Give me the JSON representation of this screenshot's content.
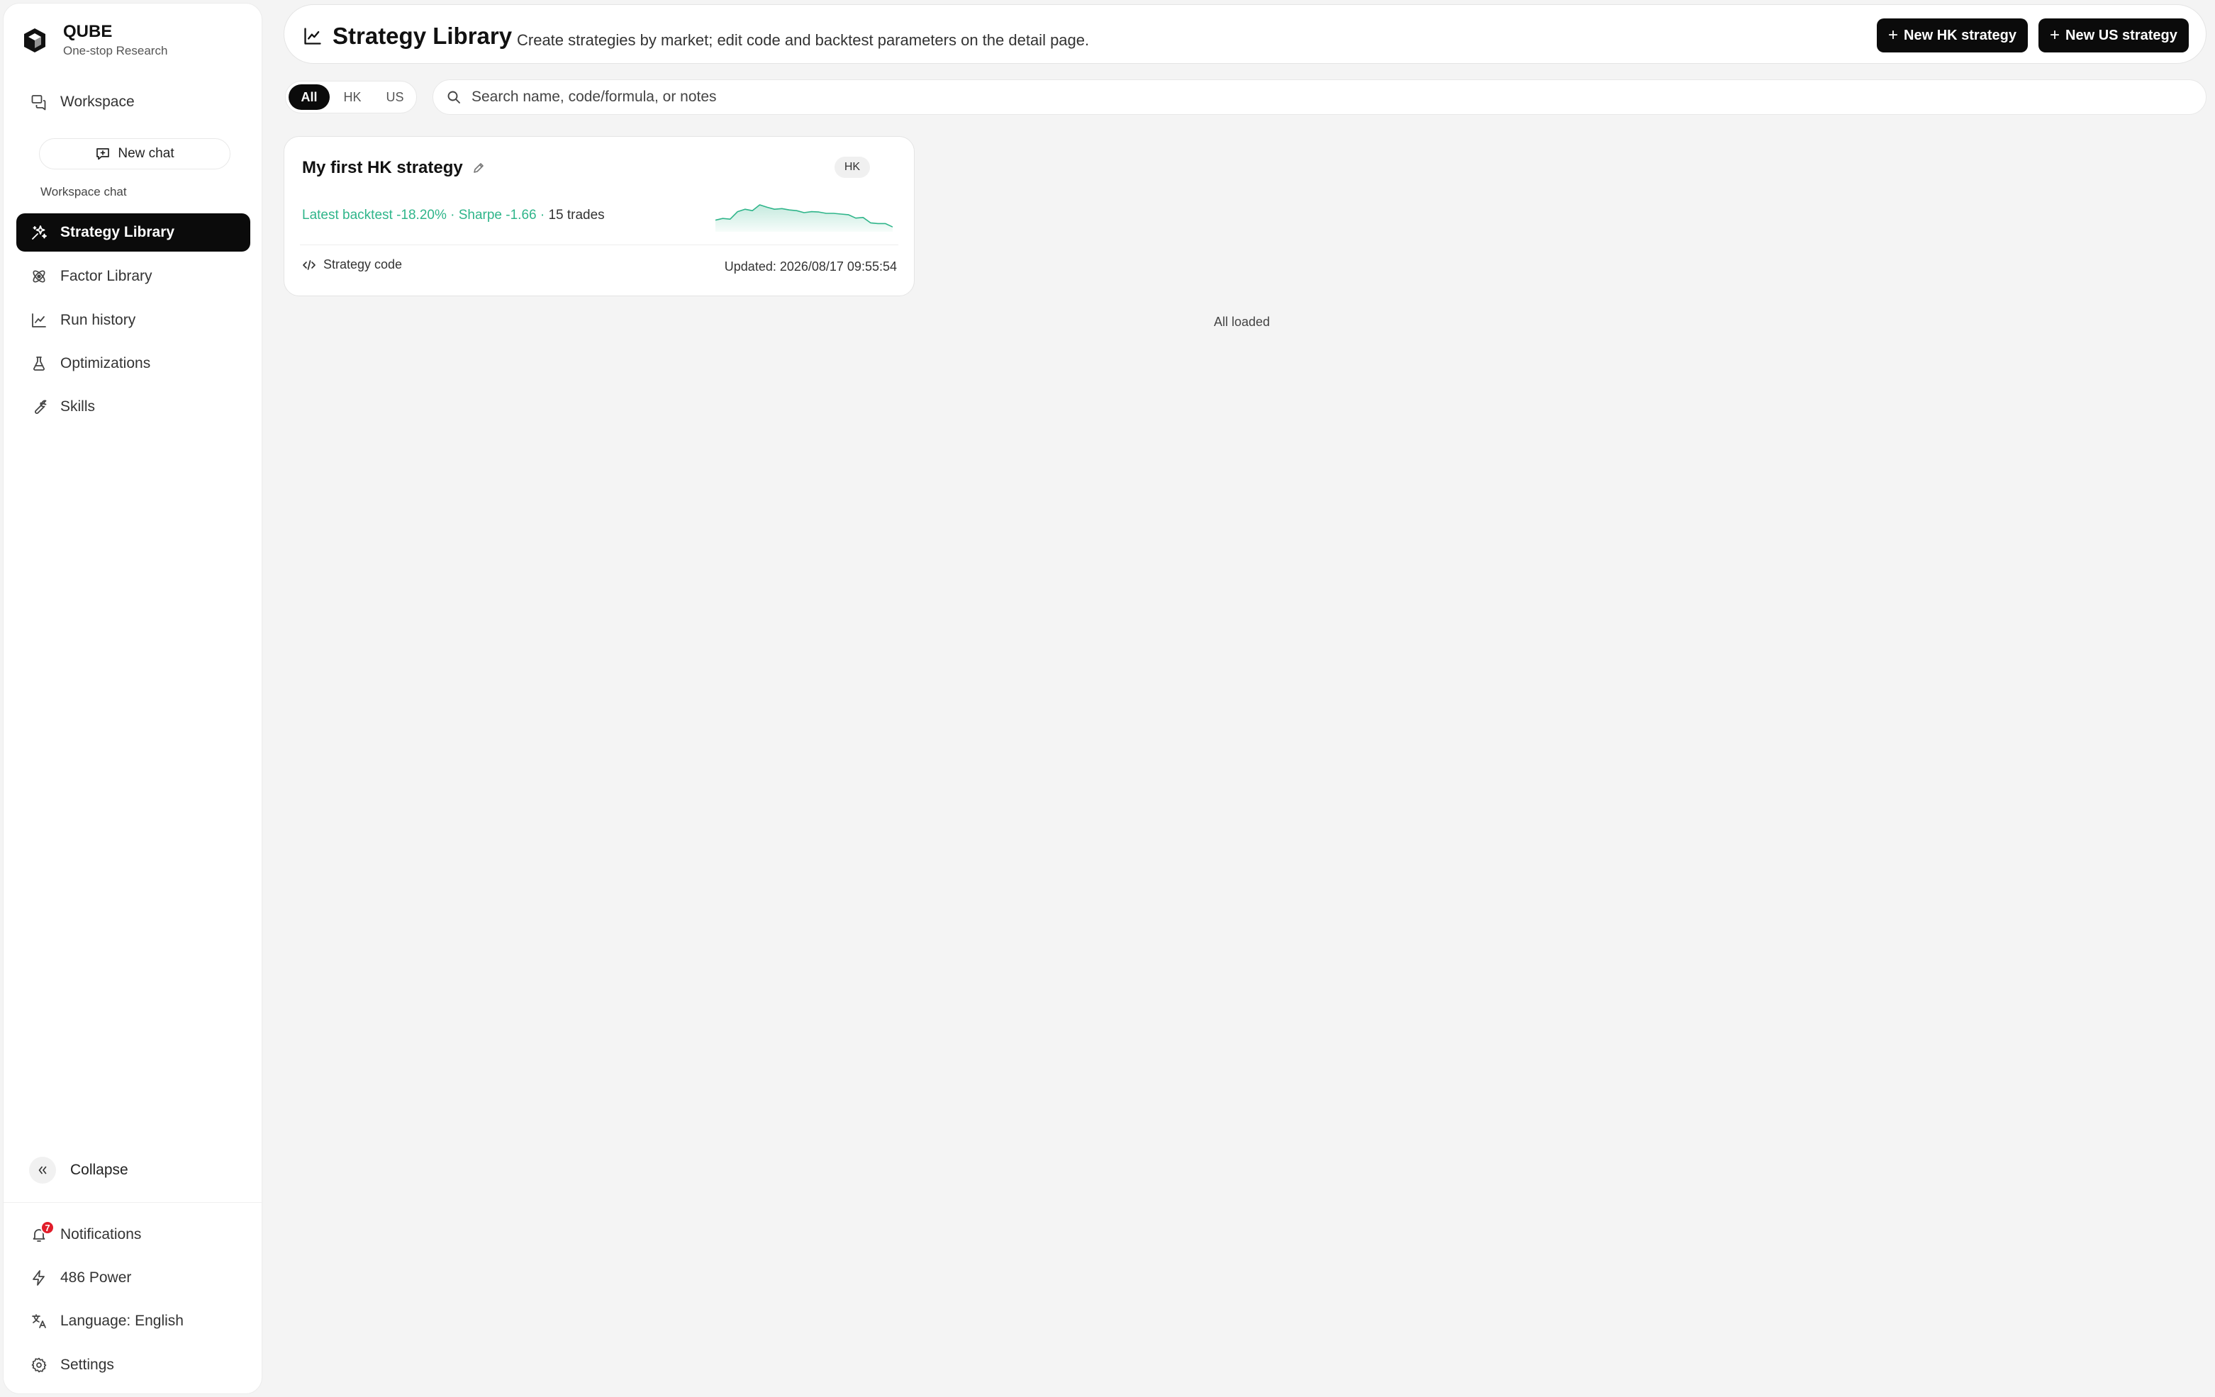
{
  "brand": {
    "name": "QUBE",
    "tagline": "One-stop Research"
  },
  "sidebar": {
    "workspace": "Workspace",
    "new_chat": "New chat",
    "section_label": "Workspace chat",
    "items": [
      {
        "label": "Strategy Library",
        "icon": "sparkle-icon",
        "active": true
      },
      {
        "label": "Factor Library",
        "icon": "atom-icon"
      },
      {
        "label": "Run history",
        "icon": "line-chart-icon"
      },
      {
        "label": "Optimizations",
        "icon": "flask-icon"
      },
      {
        "label": "Skills",
        "icon": "wrench-icon"
      }
    ],
    "collapse": "Collapse",
    "notifications": "Notifications",
    "notification_count": "7",
    "power": "486 Power",
    "language": "Language: English",
    "settings": "Settings"
  },
  "header": {
    "title": "Strategy Library",
    "subtitle": "Create strategies by market; edit code and backtest parameters on the detail page.",
    "new_hk": "New HK strategy",
    "new_us": "New US strategy"
  },
  "filters": {
    "tabs": [
      "All",
      "HK",
      "US"
    ],
    "selected": "All",
    "search_placeholder": "Search name, code/formula, or notes",
    "search_value": ""
  },
  "strategies": [
    {
      "name": "My first HK strategy",
      "market": "HK",
      "metrics_text": "Latest backtest -18.20% · Sharpe -1.66 ·",
      "trades_text": " 15 trades",
      "code_label": "Strategy code",
      "updated": "Updated: 2026/08/17 09:55:54",
      "sparkline": [
        0.3,
        0.35,
        0.33,
        0.55,
        0.62,
        0.58,
        0.75,
        0.68,
        0.62,
        0.64,
        0.6,
        0.58,
        0.52,
        0.55,
        0.54,
        0.5,
        0.5,
        0.48,
        0.46,
        0.36,
        0.38,
        0.22,
        0.2,
        0.2,
        0.1
      ]
    }
  ],
  "footer_text": "All loaded",
  "colors": {
    "accent": "#0b0b0b",
    "positive": "#2fb58a",
    "badge": "#e11d2a"
  }
}
